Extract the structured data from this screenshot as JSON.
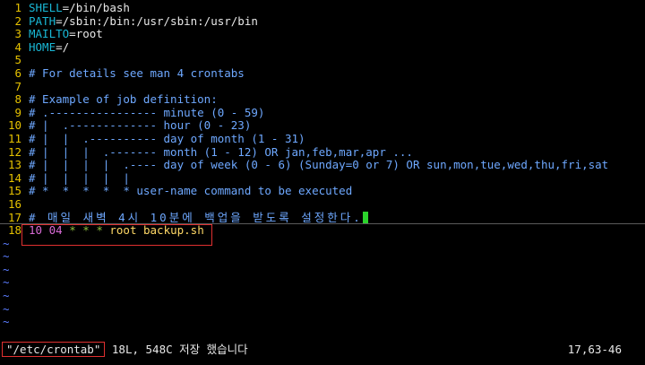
{
  "editor": {
    "lines": [
      {
        "num": "1",
        "var": "SHELL",
        "value": "/bin/bash"
      },
      {
        "num": "2",
        "var": "PATH",
        "value": "/sbin:/bin:/usr/sbin:/usr/bin"
      },
      {
        "num": "3",
        "var": "MAILTO",
        "value": "root"
      },
      {
        "num": "4",
        "var": "HOME",
        "value": "/"
      },
      {
        "num": "5"
      },
      {
        "num": "6",
        "comment": "# For details see man 4 crontabs"
      },
      {
        "num": "7"
      },
      {
        "num": "8",
        "comment": "# Example of job definition:"
      },
      {
        "num": "9",
        "comment": "# .---------------- minute (0 - 59)"
      },
      {
        "num": "10",
        "comment": "# |  .------------- hour (0 - 23)"
      },
      {
        "num": "11",
        "comment": "# |  |  .---------- day of month (1 - 31)"
      },
      {
        "num": "12",
        "comment": "# |  |  |  .------- month (1 - 12) OR jan,feb,mar,apr ..."
      },
      {
        "num": "13",
        "comment": "# |  |  |  |  .---- day of week (0 - 6) (Sunday=0 or 7) OR sun,mon,tue,wed,thu,fri,sat"
      },
      {
        "num": "14",
        "comment": "# |  |  |  |  |"
      },
      {
        "num": "15",
        "comment": "# *  *  *  *  * user-name command to be executed"
      },
      {
        "num": "16"
      },
      {
        "num": "17",
        "comment": "# 매일 새벽 4시 10분에 백업을 받도록 설정한다."
      },
      {
        "num": "18",
        "minute": "10",
        "hour": "04",
        "star1": "*",
        "star2": "*",
        "star3": "*",
        "command": "root backup.sh"
      }
    ],
    "tilde": "~"
  },
  "statusbar": {
    "filename": "\"/etc/crontab\"",
    "info": "18L, 548C 저장 했습니다",
    "ruler": "17,63-46"
  },
  "colors": {
    "line_number": "#e6c200",
    "comment": "#6ea8ff",
    "variable": "#19b8d6",
    "number": "#d96bd6",
    "star": "#8fbf3f",
    "command": "#ffd866",
    "cursor": "#2cd42c",
    "highlight_box": "#e03030",
    "tilde": "#5b7cff"
  }
}
